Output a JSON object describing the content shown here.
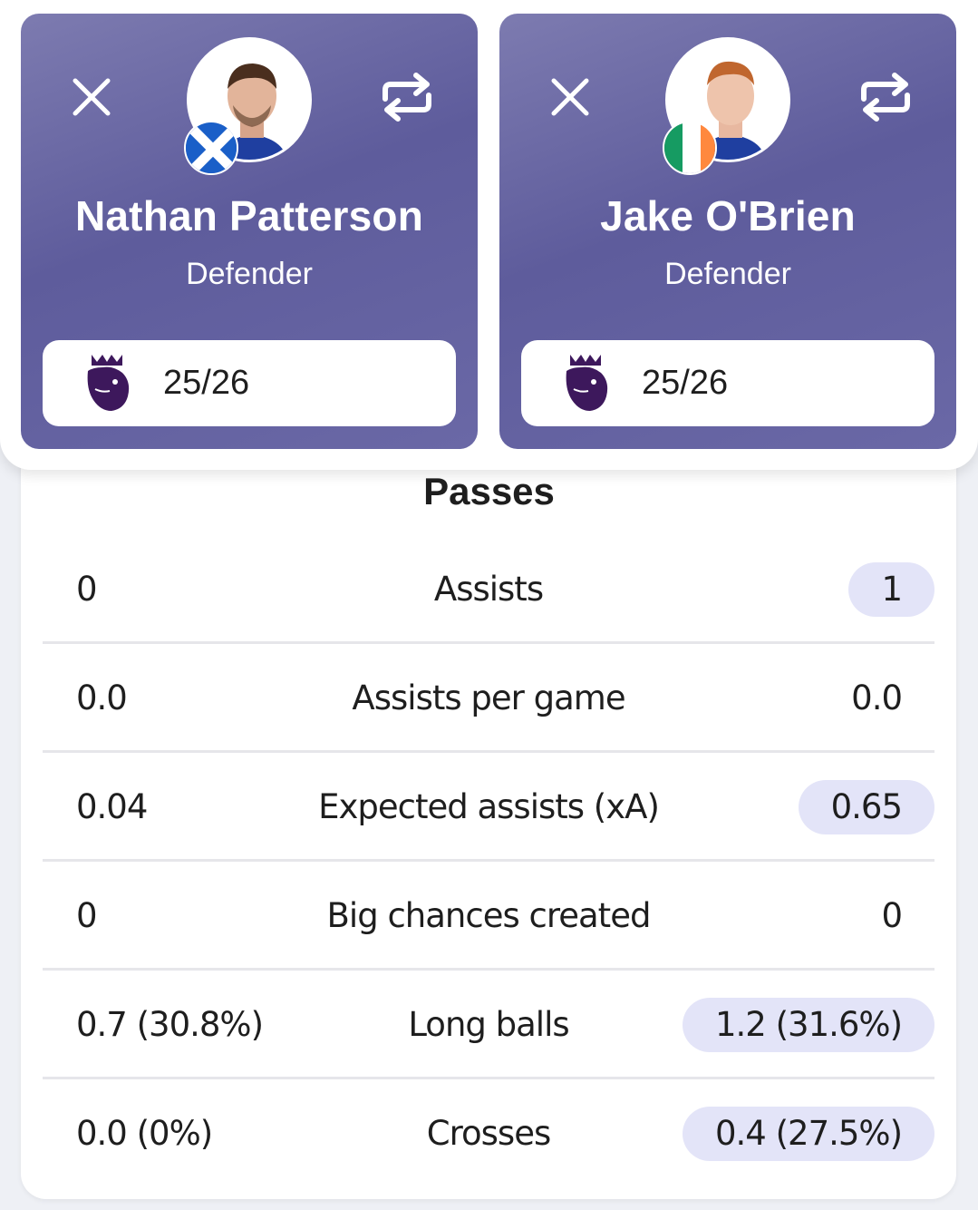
{
  "players": [
    {
      "name": "Nathan Patterson",
      "position": "Defender",
      "season": "25/26",
      "flag": "scotland-flag"
    },
    {
      "name": "Jake O'Brien",
      "position": "Defender",
      "season": "25/26",
      "flag": "ireland-flag"
    }
  ],
  "section": {
    "title": "Passes"
  },
  "stats": [
    {
      "label": "Assists",
      "left": "0",
      "right": "1",
      "better": "right"
    },
    {
      "label": "Assists per game",
      "left": "0.0",
      "right": "0.0",
      "better": "none"
    },
    {
      "label": "Expected assists (xA)",
      "left": "0.04",
      "right": "0.65",
      "better": "right"
    },
    {
      "label": "Big chances created",
      "left": "0",
      "right": "0",
      "better": "none"
    },
    {
      "label": "Long balls",
      "left": "0.7 (30.8%)",
      "right": "1.2 (31.6%)",
      "better": "right"
    },
    {
      "label": "Crosses",
      "left": "0.0 (0%)",
      "right": "0.4 (27.5%)",
      "better": "right"
    }
  ],
  "colors": {
    "card_gradient_start": "#7d7bb0",
    "card_gradient_mid": "#5e5c9c",
    "highlight": "#e3e4f8",
    "league_purple": "#3d185c"
  },
  "icons": [
    "close-icon",
    "swap-icon",
    "premier-league-logo",
    "scotland-flag",
    "ireland-flag"
  ]
}
